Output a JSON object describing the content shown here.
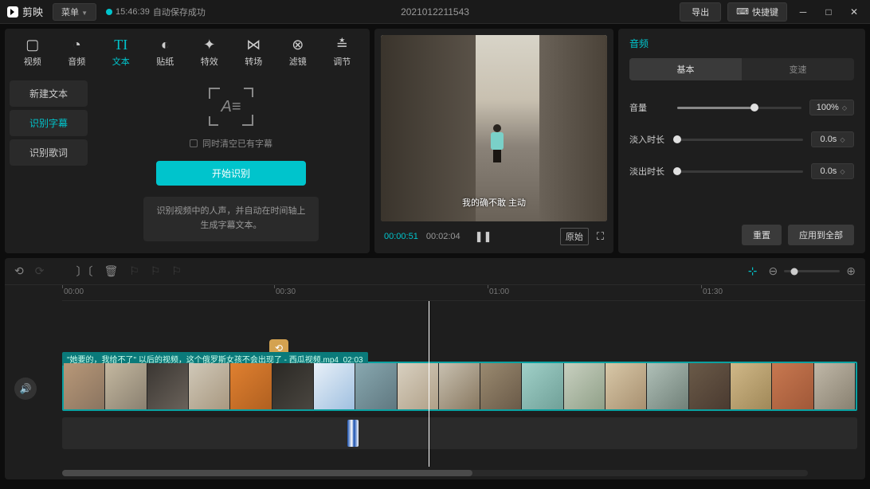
{
  "titlebar": {
    "app_name": "剪映",
    "menu_label": "菜单",
    "save_time": "15:46:39",
    "save_status": "自动保存成功",
    "project_name": "2021012211543",
    "export_label": "导出",
    "hotkey_label": "快捷键"
  },
  "media_tabs": [
    {
      "label": "视频",
      "icon": "▸"
    },
    {
      "label": "音频",
      "icon": "◔"
    },
    {
      "label": "文本",
      "icon": "TI",
      "active": true
    },
    {
      "label": "贴纸",
      "icon": "◐"
    },
    {
      "label": "特效",
      "icon": "✦"
    },
    {
      "label": "转场",
      "icon": "⋈"
    },
    {
      "label": "滤镜",
      "icon": "⊗"
    },
    {
      "label": "调节",
      "icon": "≛"
    }
  ],
  "left_sidebar": [
    {
      "label": "新建文本"
    },
    {
      "label": "识别字幕",
      "active": true
    },
    {
      "label": "识别歌词"
    }
  ],
  "subtitle_panel": {
    "icon_text": "A≡",
    "checkbox_label": "同时清空已有字幕",
    "start_button": "开始识别",
    "hint": "识别视频中的人声，并自动在时间轴上生成字幕文本。"
  },
  "preview": {
    "subtitle": "我的确不敢 主动",
    "current_time": "00:00:51",
    "duration": "00:02:04",
    "ratio_label": "原始"
  },
  "right_panel": {
    "title": "音频",
    "tabs": [
      {
        "label": "基本",
        "active": true
      },
      {
        "label": "变速"
      }
    ],
    "rows": [
      {
        "label": "音量",
        "value": "100%",
        "fill": 62
      },
      {
        "label": "淡入时长",
        "value": "0.0s",
        "fill": 0
      },
      {
        "label": "淡出时长",
        "value": "0.0s",
        "fill": 0
      }
    ],
    "reset_label": "重置",
    "apply_all_label": "应用到全部"
  },
  "timeline": {
    "ruler": [
      "00:00",
      "00:30",
      "01:00",
      "01:30"
    ],
    "clip_label": "\"她要的，我给不了\" 以后的视频，这个俄罗斯女孩不会出现了 - 西瓜视频.mp4",
    "clip_duration": "02:03"
  }
}
